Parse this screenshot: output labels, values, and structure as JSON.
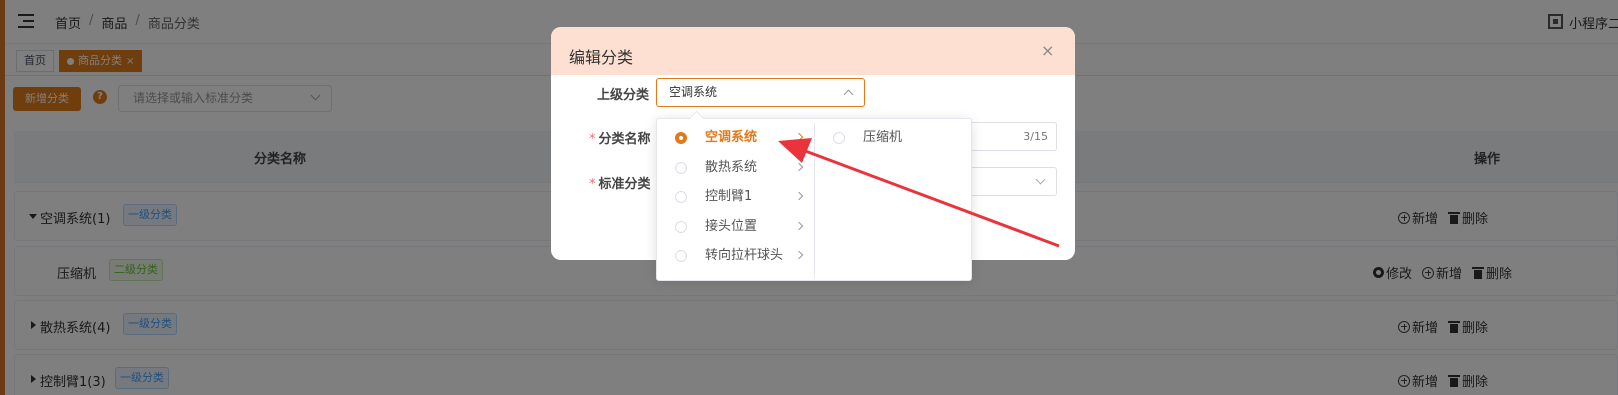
{
  "header": {
    "breadcrumb": [
      "首页",
      "商品",
      "商品分类"
    ],
    "breadcrumb_sep": "/",
    "mini_program_label": "小程序二"
  },
  "tags": {
    "home": "首页",
    "active": "商品分类",
    "close_symbol": "×"
  },
  "toolbar": {
    "add_label": "新增分类",
    "help_symbol": "?",
    "std_placeholder": "请选择或输入标准分类"
  },
  "table": {
    "col_name": "分类名称",
    "col_ops": "操作",
    "rows": [
      {
        "name": "空调系统(1)",
        "level": "一级分类",
        "ops": [
          "新增",
          "删除"
        ]
      },
      {
        "name": "压缩机",
        "level": "二级分类",
        "ops": [
          "修改",
          "新增",
          "删除"
        ]
      },
      {
        "name": "散热系统(4)",
        "level": "一级分类",
        "ops": [
          "新增",
          "删除"
        ]
      },
      {
        "name": "控制臂1(3)",
        "level": "一级分类",
        "ops": [
          "新增",
          "删除"
        ]
      }
    ]
  },
  "dialog": {
    "title": "编辑分类",
    "close_symbol": "×",
    "parent_label": "上级分类",
    "parent_value": "空调系统",
    "name_label": "分类名称",
    "name_counter": "3/15",
    "std_label": "标准分类",
    "required_mark": "*"
  },
  "cascader": {
    "level1": [
      "空调系统",
      "散热系统",
      "控制臂1",
      "接头位置",
      "转向拉杆球头"
    ],
    "level1_selected": "空调系统",
    "level2": [
      "压缩机"
    ]
  },
  "colors": {
    "accent": "#e07a1b",
    "header_bg": "#fde0d2",
    "annotation_arrow": "#e8343a"
  }
}
